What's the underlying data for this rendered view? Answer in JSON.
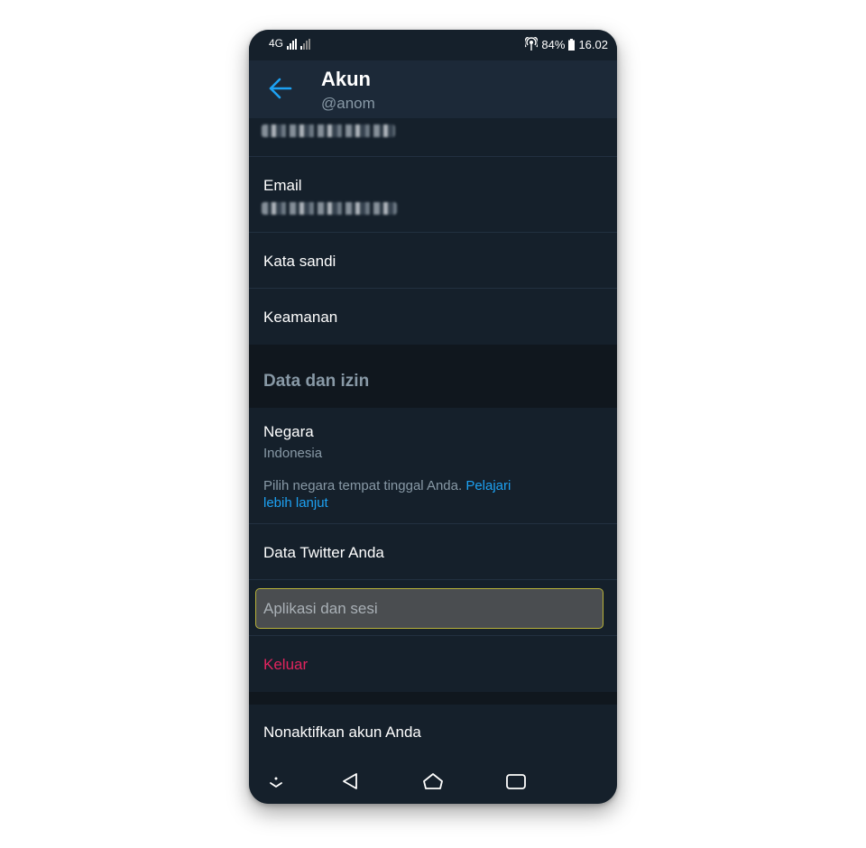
{
  "status": {
    "network": "4G",
    "battery": "84%",
    "time": "16.02"
  },
  "header": {
    "title": "Akun",
    "handle": "@anom"
  },
  "rows": {
    "email_label": "Email",
    "password_label": "Kata sandi",
    "security_label": "Keamanan",
    "section_title": "Data dan izin",
    "country_label": "Negara",
    "country_value": "Indonesia",
    "country_help": "Pilih negara tempat tinggal Anda. ",
    "country_help_link": "Pelajari lebih lanjut",
    "twitter_data_label": "Data Twitter Anda",
    "apps_sessions_label": "Aplikasi dan sesi",
    "logout_label": "Keluar",
    "deactivate_label": "Nonaktifkan akun Anda"
  },
  "colors": {
    "background": "#15202b",
    "header": "#1c2938",
    "accent": "#1da1f2",
    "danger": "#e0245e",
    "muted": "#8899a6"
  },
  "icons": {
    "back": "arrow-left-icon",
    "nav_down": "chevron-down-icon",
    "nav_back": "triangle-back-icon",
    "nav_home": "home-icon",
    "nav_recent": "recent-apps-icon",
    "hotspot": "hotspot-icon",
    "battery": "battery-icon"
  }
}
